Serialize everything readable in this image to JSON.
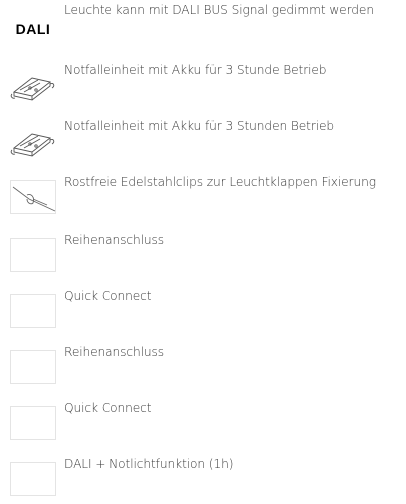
{
  "features": [
    {
      "icon": "dali-logo-icon",
      "icon_text": "DALI",
      "text": "Leuchte kann mit DALI BUS Signal gedimmt werden"
    },
    {
      "icon": "emergency-battery-unit-icon",
      "text": "Notfalleinheit mit Akku für 3 Stunde Betrieb"
    },
    {
      "icon": "emergency-battery-unit-icon",
      "text": "Notfalleinheit mit Akku für 3 Stunden Betrieb"
    },
    {
      "icon": "stainless-clip-icon",
      "text": "Rostfreie Edelstahlclips zur Leuchtklappen Fixierung"
    },
    {
      "icon": "blank-image-icon",
      "text": "Reihenanschluss"
    },
    {
      "icon": "blank-image-icon",
      "text": "Quick Connect"
    },
    {
      "icon": "blank-image-icon",
      "text": "Reihenanschluss"
    },
    {
      "icon": "blank-image-icon",
      "text": "Quick Connect"
    },
    {
      "icon": "blank-image-icon",
      "text": "DALI + Notlichtfunktion (1h)"
    }
  ],
  "colors": {
    "text": "#3a3a3a",
    "icon_border": "#e4e4e4",
    "logo": "#000000"
  }
}
